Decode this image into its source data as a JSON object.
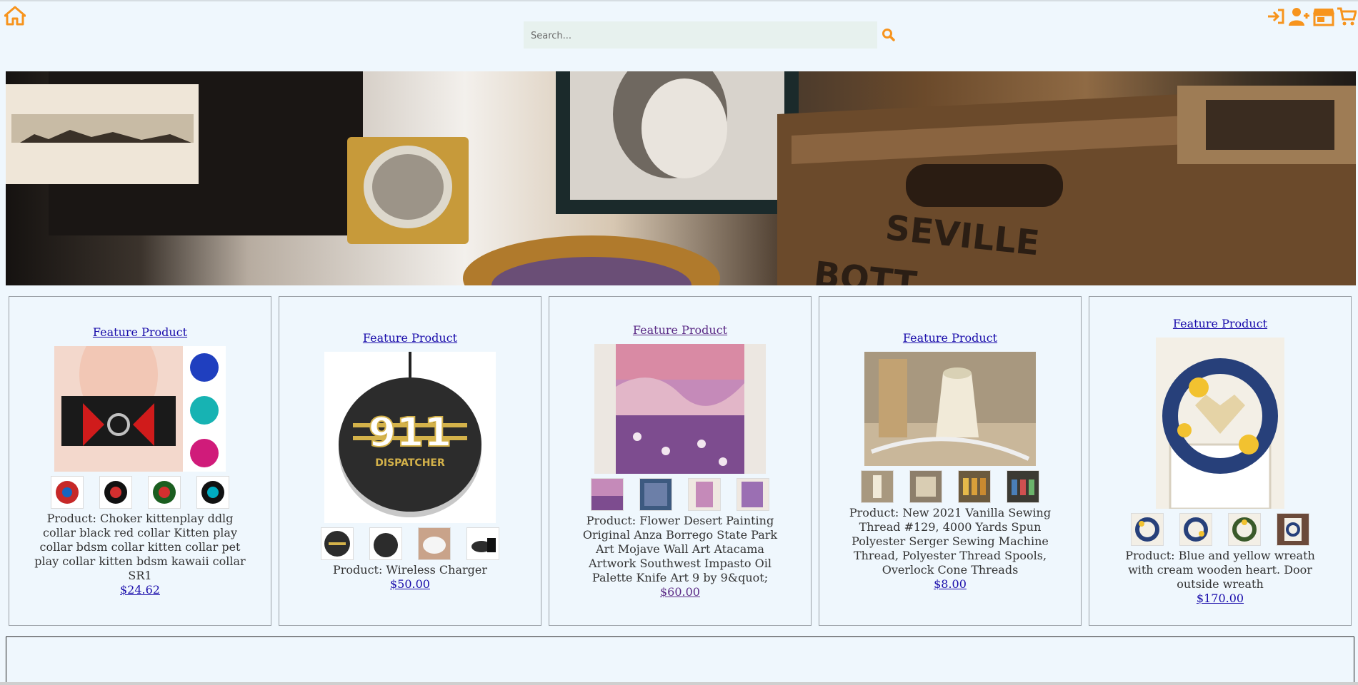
{
  "search": {
    "placeholder": "Search..."
  },
  "icons": {
    "home": "home-icon",
    "search": "magnifier-icon",
    "login": "sign-in-icon",
    "register": "user-plus-icon",
    "store": "store-icon",
    "cart": "cart-icon"
  },
  "colors": {
    "accent": "#f7941d",
    "link": "#1a0dab",
    "visited": "#5b2a86",
    "page_bg": "#eff7fd"
  },
  "banner": {
    "description_icon": "vintage-photos-banner"
  },
  "products": [
    {
      "feature_label": "Feature Product",
      "name": "Product: Choker kittenplay ddlg collar black red collar Kitten play collar bdsm collar kitten collar pet play collar kitten bdsm kawaii collar SR1",
      "price": "$24.62",
      "thumb_count": 4
    },
    {
      "feature_label": "Feature Product",
      "name": "Product: Wireless Charger",
      "price": "$50.00",
      "thumb_count": 4
    },
    {
      "feature_label": "Feature Product",
      "name": "Product: Flower Desert Painting Original Anza Borrego State Park Art Mojave Wall Art Atacama Artwork Southwest Impasto Oil Palette Knife Art 9 by 9&quot;",
      "price": "$60.00",
      "thumb_count": 4
    },
    {
      "feature_label": "Feature Product",
      "name": "Product: New 2021 Vanilla Sewing Thread #129, 4000 Yards Spun Polyester Serger Sewing Machine Thread, Polyester Thread Spools, Overlock Cone Threads",
      "price": "$8.00",
      "thumb_count": 4
    },
    {
      "feature_label": "Feature Product",
      "name": "Product: Blue and yellow wreath with cream wooden heart. Door outside wreath",
      "price": "$170.00",
      "thumb_count": 4
    }
  ]
}
